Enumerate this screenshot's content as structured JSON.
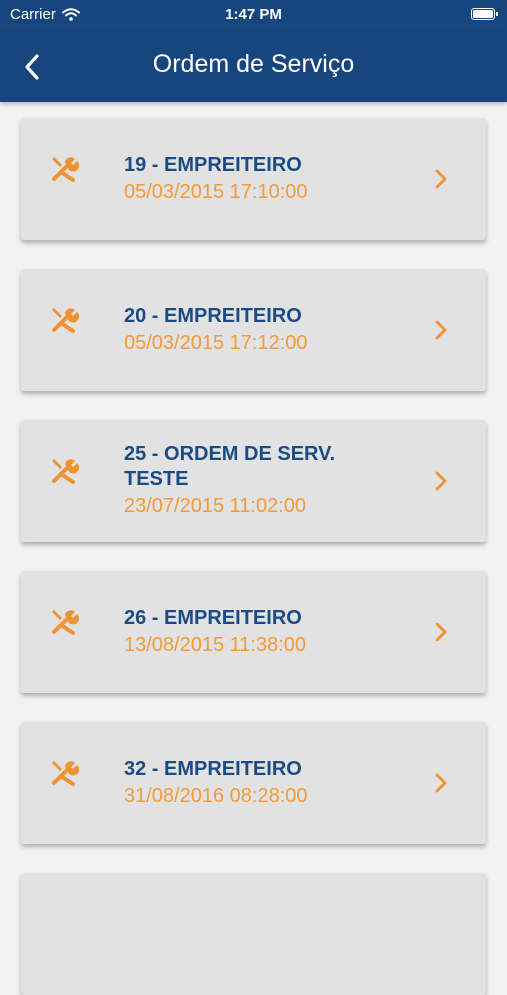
{
  "status_bar": {
    "carrier": "Carrier",
    "time": "1:47 PM"
  },
  "header": {
    "title": "Ordem de Serviço",
    "back_icon": "chevron-left-icon"
  },
  "colors": {
    "header_bg": "#17457d",
    "accent": "#f39a3a",
    "item_title": "#1b4b84",
    "card_bg": "#e2e2e2"
  },
  "orders": [
    {
      "title": "19 - EMPREITEIRO",
      "date": "05/03/2015 17:10:00",
      "icon": "tools-icon"
    },
    {
      "title": "20 - EMPREITEIRO",
      "date": "05/03/2015 17:12:00",
      "icon": "tools-icon"
    },
    {
      "title": "25 - ORDEM DE SERV. TESTE",
      "date": "23/07/2015 11:02:00",
      "icon": "tools-icon"
    },
    {
      "title": "26 - EMPREITEIRO",
      "date": "13/08/2015 11:38:00",
      "icon": "tools-icon"
    },
    {
      "title": "32 - EMPREITEIRO",
      "date": "31/08/2016 08:28:00",
      "icon": "tools-icon"
    }
  ]
}
